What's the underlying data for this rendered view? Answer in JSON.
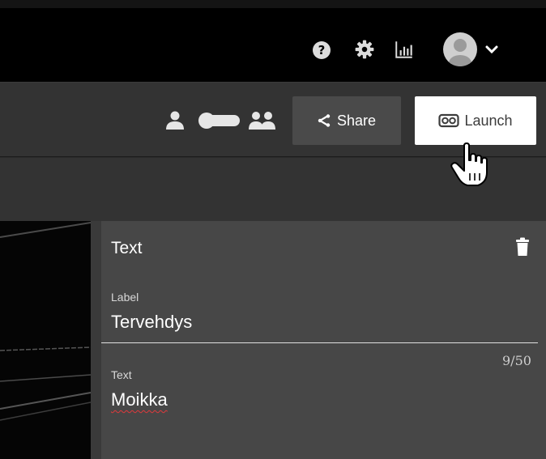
{
  "header": {
    "icons": [
      "help-icon",
      "gear-icon",
      "stats-icon",
      "avatar",
      "chevron-down-icon"
    ],
    "help_glyph": "?"
  },
  "toolbar": {
    "share_label": "Share",
    "launch_label": "Launch",
    "toggle_icons": [
      "single-user-icon",
      "toggle-switch",
      "multi-user-icon"
    ]
  },
  "panel": {
    "title": "Text",
    "label_caption": "Label",
    "label_value": "Tervehdys",
    "counter": "9/50",
    "text_caption": "Text",
    "text_value": "Moikka"
  },
  "colors": {
    "topbar": "#000000",
    "toolbar": "#333333",
    "panel": "#474747",
    "share_button": "#4a4a4a",
    "launch_button": "#ffffff",
    "spellcheck_underline": "#e0383b"
  }
}
